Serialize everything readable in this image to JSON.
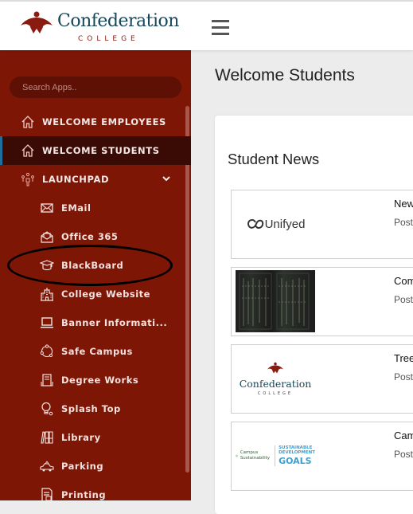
{
  "brand": {
    "name": "Confederation",
    "subtitle": "COLLEGE",
    "primary_color": "#7e1606",
    "text_color": "#17485a"
  },
  "topbar": {
    "menu_icon": "hamburger-icon"
  },
  "sidebar": {
    "search": {
      "placeholder": "Search Apps..",
      "value": ""
    },
    "items": [
      {
        "label": "WELCOME EMPLOYEES",
        "icon": "home-icon",
        "active": false
      },
      {
        "label": "WELCOME STUDENTS",
        "icon": "home-icon",
        "active": true
      },
      {
        "label": "LAUNCHPAD",
        "icon": "network-people-icon",
        "expanded": true
      }
    ],
    "launchpad_items": [
      {
        "label": "EMail",
        "icon": "envelope-icon"
      },
      {
        "label": "Office 365",
        "icon": "open-envelope-icon"
      },
      {
        "label": "BlackBoard",
        "icon": "graduation-cap-icon"
      },
      {
        "label": "College Website",
        "icon": "building-icon"
      },
      {
        "label": "Banner Informati...",
        "icon": "laptop-icon"
      },
      {
        "label": "Safe Campus",
        "icon": "circle-nodes-icon"
      },
      {
        "label": "Degree Works",
        "icon": "document-person-icon"
      },
      {
        "label": "Splash Top",
        "icon": "lightbulb-icon"
      },
      {
        "label": "Library",
        "icon": "books-icon"
      },
      {
        "label": "Parking",
        "icon": "car-icon"
      },
      {
        "label": "Printing",
        "icon": "printer-doc-icon"
      }
    ],
    "annotation": "BlackBoard"
  },
  "main": {
    "page_title": "Welcome Students",
    "section_title": "Student News",
    "news": [
      {
        "title": "New",
        "meta": "Post",
        "thumb": "Unifyed"
      },
      {
        "title": "Com",
        "meta": "Post",
        "thumb": "server-rack-photo"
      },
      {
        "title": "Tree",
        "meta": "Post",
        "thumb": "Confederation College logo",
        "thumb_word": "Confederation",
        "thumb_sub": "COLLEGE"
      },
      {
        "title": "Cam",
        "meta": "Post",
        "thumb": "Campus Sustainability SDG",
        "thumb_line1": "Campus",
        "thumb_line2": "Sustainability",
        "thumb_goals_top": "SUSTAINABLE DEVELOPMENT",
        "thumb_goals": "GOALS"
      }
    ]
  }
}
